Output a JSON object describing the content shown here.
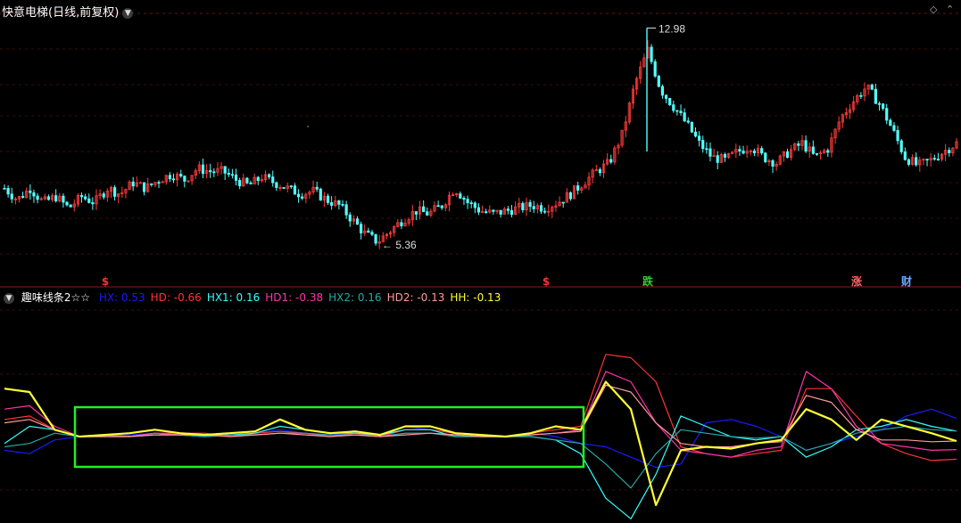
{
  "main_title": "快意电梯(日线,前复权)",
  "indicator": {
    "name": "趣味线条2☆☆",
    "values": [
      {
        "label": "HX: 0.53",
        "color": "#1a1aff"
      },
      {
        "label": "HD: -0.66",
        "color": "#ff3333"
      },
      {
        "label": "HX1: 0.16",
        "color": "#33ffff"
      },
      {
        "label": "HD1: -0.38",
        "color": "#ff33aa"
      },
      {
        "label": "HX2: 0.16",
        "color": "#2aa6a6"
      },
      {
        "label": "HD2: -0.13",
        "color": "#ff9999"
      },
      {
        "label": "HH: -0.13",
        "color": "#ffff33"
      }
    ]
  },
  "chart_data": [
    {
      "type": "candlestick",
      "title": "快意电梯(日线,前复权)",
      "annotations": [
        {
          "text": "12.98",
          "kind": "high"
        },
        {
          "text": "5.36",
          "kind": "low"
        }
      ],
      "signal_markers": [
        {
          "text": "$",
          "color": "#ff3030"
        },
        {
          "text": "$",
          "color": "#ff3030"
        },
        {
          "text": "跌",
          "color": "#33cc33"
        },
        {
          "text": "涨",
          "color": "#ff6666"
        },
        {
          "text": "财",
          "color": "#66aaff"
        }
      ],
      "ylim": [
        4.5,
        13.5
      ],
      "price_path": [
        7.3,
        6.9,
        7.3,
        6.8,
        7.0,
        6.6,
        7.0,
        6.8,
        7.3,
        7.1,
        7.5,
        7.3,
        7.6,
        7.8,
        7.6,
        8.0,
        7.9,
        7.9,
        7.6,
        7.4,
        7.7,
        7.5,
        7.3,
        7.1,
        7.2,
        6.9,
        6.7,
        6.2,
        5.7,
        5.4,
        5.8,
        6.2,
        6.5,
        6.4,
        6.7,
        7.3,
        6.8,
        6.5,
        6.4,
        6.5,
        6.6,
        6.7,
        6.6,
        6.8,
        7.1,
        7.5,
        7.9,
        8.2,
        9.2,
        11.0,
        12.2,
        10.8,
        10.2,
        9.6,
        8.9,
        8.4,
        8.3,
        8.6,
        8.8,
        8.4,
        8.2,
        8.6,
        8.9,
        8.4,
        8.7,
        9.8,
        10.4,
        10.9,
        10.3,
        9.4,
        8.4,
        8.1,
        8.3,
        8.6,
        8.9
      ]
    },
    {
      "type": "line",
      "title": "趣味线条2☆☆",
      "series": [
        {
          "name": "HX",
          "color": "#1a1aff",
          "values": [
            -0.4,
            -0.5,
            -0.1,
            0.0,
            0.02,
            0.05,
            0.1,
            0.05,
            0.0,
            0.05,
            0.1,
            0.2,
            0.1,
            0.05,
            0.1,
            0.0,
            0.3,
            0.2,
            0.1,
            0.05,
            0.0,
            0.1,
            0.0,
            -0.2,
            -0.3,
            -0.6,
            -0.9,
            -0.8,
            0.4,
            0.5,
            0.3,
            0.0,
            -0.4,
            -0.2,
            0.0,
            0.2,
            0.6,
            0.8,
            0.53
          ]
        },
        {
          "name": "HD",
          "color": "#ff3333",
          "values": [
            0.5,
            0.6,
            0.2,
            0.0,
            0.0,
            0.0,
            0.1,
            0.1,
            0.1,
            0.0,
            0.1,
            0.15,
            0.1,
            0.0,
            0.1,
            0.0,
            0.2,
            0.2,
            0.1,
            0.05,
            0.0,
            0.1,
            0.2,
            0.3,
            2.4,
            2.3,
            1.6,
            -0.3,
            -0.5,
            -0.6,
            -0.5,
            -0.4,
            1.4,
            1.4,
            0.6,
            -0.2,
            -0.5,
            -0.7,
            -0.66
          ]
        },
        {
          "name": "HX1",
          "color": "#33ffff",
          "values": [
            -0.2,
            0.3,
            0.2,
            0.0,
            0.05,
            0.0,
            0.1,
            0.05,
            0.0,
            0.05,
            0.1,
            0.3,
            0.2,
            0.1,
            0.1,
            0.05,
            0.2,
            0.2,
            0.0,
            0.0,
            0.0,
            0.0,
            -0.1,
            -0.5,
            -1.8,
            -2.4,
            -1.1,
            0.6,
            0.3,
            0.0,
            -0.1,
            0.0,
            -0.6,
            -0.3,
            0.2,
            0.3,
            0.5,
            0.3,
            0.16
          ]
        },
        {
          "name": "HD1",
          "color": "#ff33aa",
          "values": [
            0.8,
            0.9,
            0.3,
            0.0,
            0.05,
            0.0,
            0.1,
            0.05,
            0.05,
            0.0,
            0.05,
            0.1,
            0.1,
            0.0,
            0.05,
            0.0,
            0.1,
            0.1,
            0.05,
            0.0,
            0.0,
            0.05,
            0.1,
            0.2,
            1.9,
            1.6,
            0.4,
            -0.4,
            -0.5,
            -0.6,
            -0.4,
            -0.3,
            1.9,
            1.4,
            0.3,
            -0.2,
            -0.3,
            -0.4,
            -0.38
          ]
        },
        {
          "name": "HX2",
          "color": "#2aa6a6",
          "values": [
            -0.3,
            -0.2,
            0.1,
            0.0,
            0.0,
            0.0,
            0.05,
            0.05,
            0.0,
            0.05,
            0.05,
            0.1,
            0.1,
            0.05,
            0.05,
            0.0,
            0.1,
            0.1,
            0.0,
            0.0,
            0.0,
            0.0,
            -0.1,
            -0.2,
            -0.8,
            -1.5,
            -0.5,
            0.2,
            0.1,
            0.0,
            -0.05,
            0.0,
            -0.4,
            -0.2,
            0.1,
            0.2,
            0.3,
            0.2,
            0.16
          ]
        },
        {
          "name": "HD2",
          "color": "#ff9999",
          "values": [
            0.4,
            0.5,
            0.2,
            0.0,
            0.0,
            0.0,
            0.05,
            0.05,
            0.05,
            0.0,
            0.05,
            0.1,
            0.05,
            0.0,
            0.05,
            0.0,
            0.05,
            0.1,
            0.05,
            0.0,
            0.0,
            0.05,
            0.1,
            0.15,
            1.5,
            1.3,
            0.4,
            -0.2,
            -0.3,
            -0.3,
            -0.2,
            -0.15,
            1.2,
            1.0,
            0.2,
            -0.1,
            -0.1,
            -0.15,
            -0.13
          ]
        },
        {
          "name": "HH",
          "color": "#ffff33",
          "values": [
            1.4,
            1.3,
            0.2,
            0.0,
            0.05,
            0.1,
            0.2,
            0.1,
            0.05,
            0.1,
            0.15,
            0.5,
            0.2,
            0.1,
            0.15,
            0.05,
            0.3,
            0.3,
            0.1,
            0.05,
            0.0,
            0.1,
            0.3,
            0.2,
            1.6,
            0.8,
            -2.0,
            -0.4,
            -0.3,
            -0.35,
            -0.2,
            -0.1,
            0.8,
            0.5,
            -0.1,
            0.5,
            0.3,
            0.1,
            -0.13
          ]
        }
      ],
      "ylim": [
        -2.6,
        2.6
      ]
    }
  ]
}
